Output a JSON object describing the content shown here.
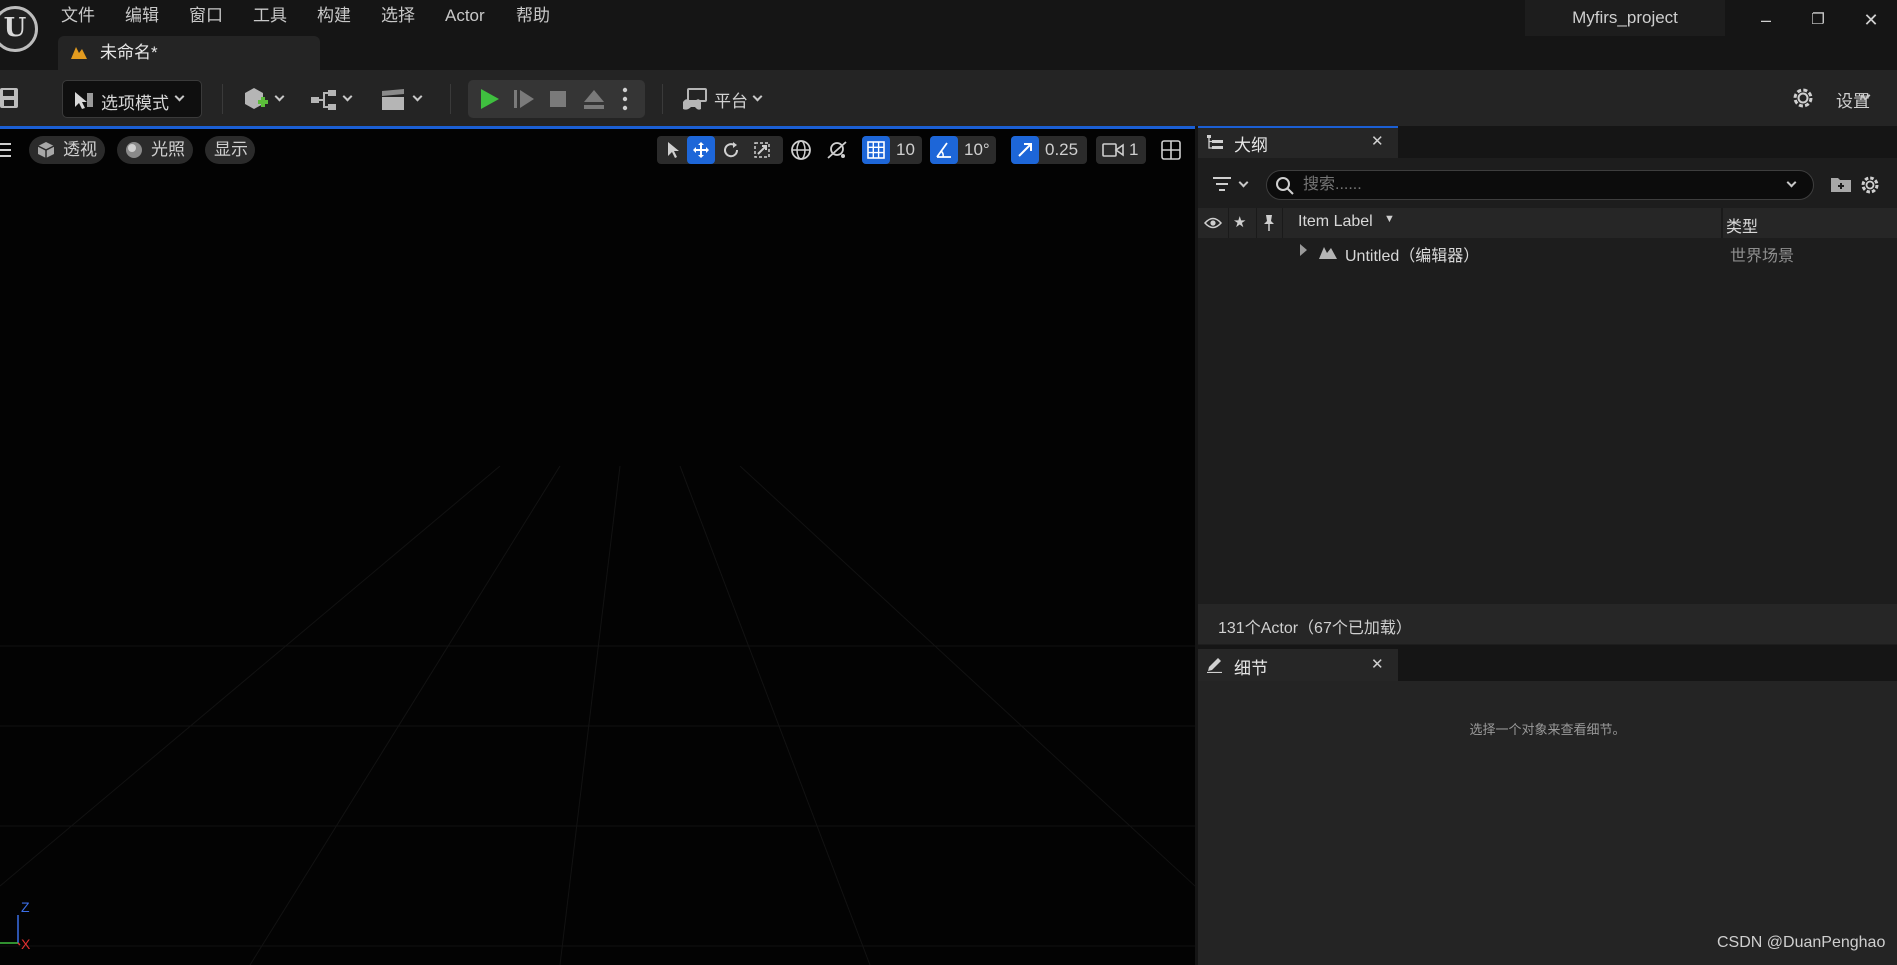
{
  "app": {
    "project_name": "Myfirs_project",
    "logo_letter": "U"
  },
  "menu": [
    "文件",
    "编辑",
    "窗口",
    "工具",
    "构建",
    "选择",
    "Actor",
    "帮助"
  ],
  "window_controls": {
    "minimize": "–",
    "restore": "❐",
    "close": "✕"
  },
  "document_tab": {
    "label": "未命名*"
  },
  "toolbar": {
    "mode_label": "选项模式",
    "platform_label": "平台",
    "settings_label": "设置",
    "play_color": "#3fbf3f"
  },
  "viewport": {
    "perspective_label": "透视",
    "lighting_label": "光照",
    "show_label": "显示",
    "grid_snap_value": "10",
    "rotation_snap_value": "10°",
    "scale_snap_value": "0.25",
    "camera_speed_value": "1",
    "axis_z": "Z",
    "axis_x": "X",
    "accent_color": "#1b5fd4"
  },
  "outliner": {
    "tab_label": "大纲",
    "search_placeholder": "搜索......",
    "columns": {
      "label": "Item Label",
      "type": "类型"
    },
    "rows": [
      {
        "label": "Untitled（编辑器）",
        "type": "世界场景"
      }
    ],
    "actor_count": "131个Actor（67个已加载）"
  },
  "details": {
    "tab_label": "细节",
    "empty_message": "选择一个对象来查看细节。"
  },
  "watermark": "CSDN @DuanPenghao"
}
